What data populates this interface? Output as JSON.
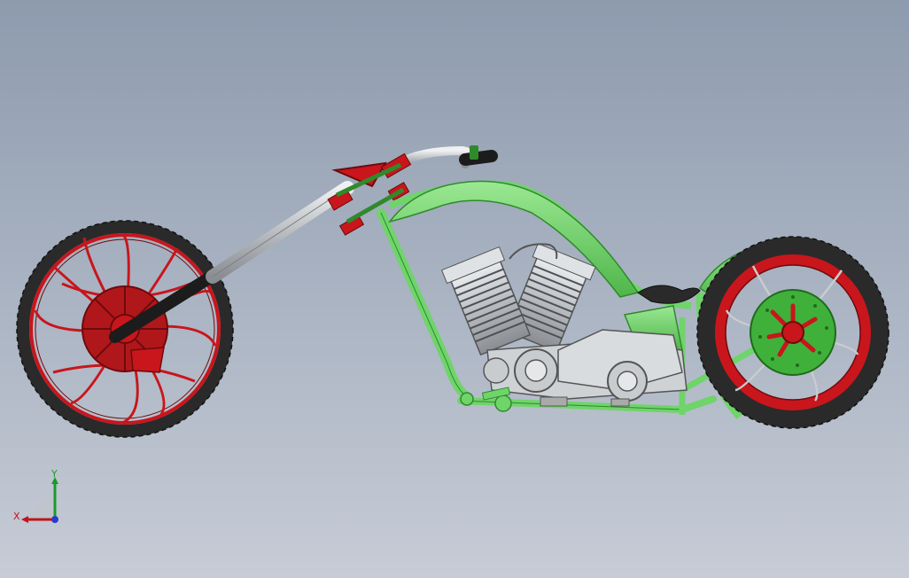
{
  "viewport": {
    "background_top": "#8e9bae",
    "background_bottom": "#c7ccd6"
  },
  "model": {
    "colors": {
      "frame": "#6fd46a",
      "frame_dark": "#2f8a2c",
      "red": "#c8161c",
      "red_dark": "#6e0a0c",
      "tire": "#2a2a2a",
      "chrome": "#c9cccf",
      "chrome_dark": "#7b7f84",
      "engine": "#cfd2d5"
    }
  },
  "triad": {
    "x_label": "X",
    "y_label": "Y",
    "x_color": "#c0141a",
    "y_color": "#1a9a2a",
    "z_color": "#2a3cc8"
  }
}
